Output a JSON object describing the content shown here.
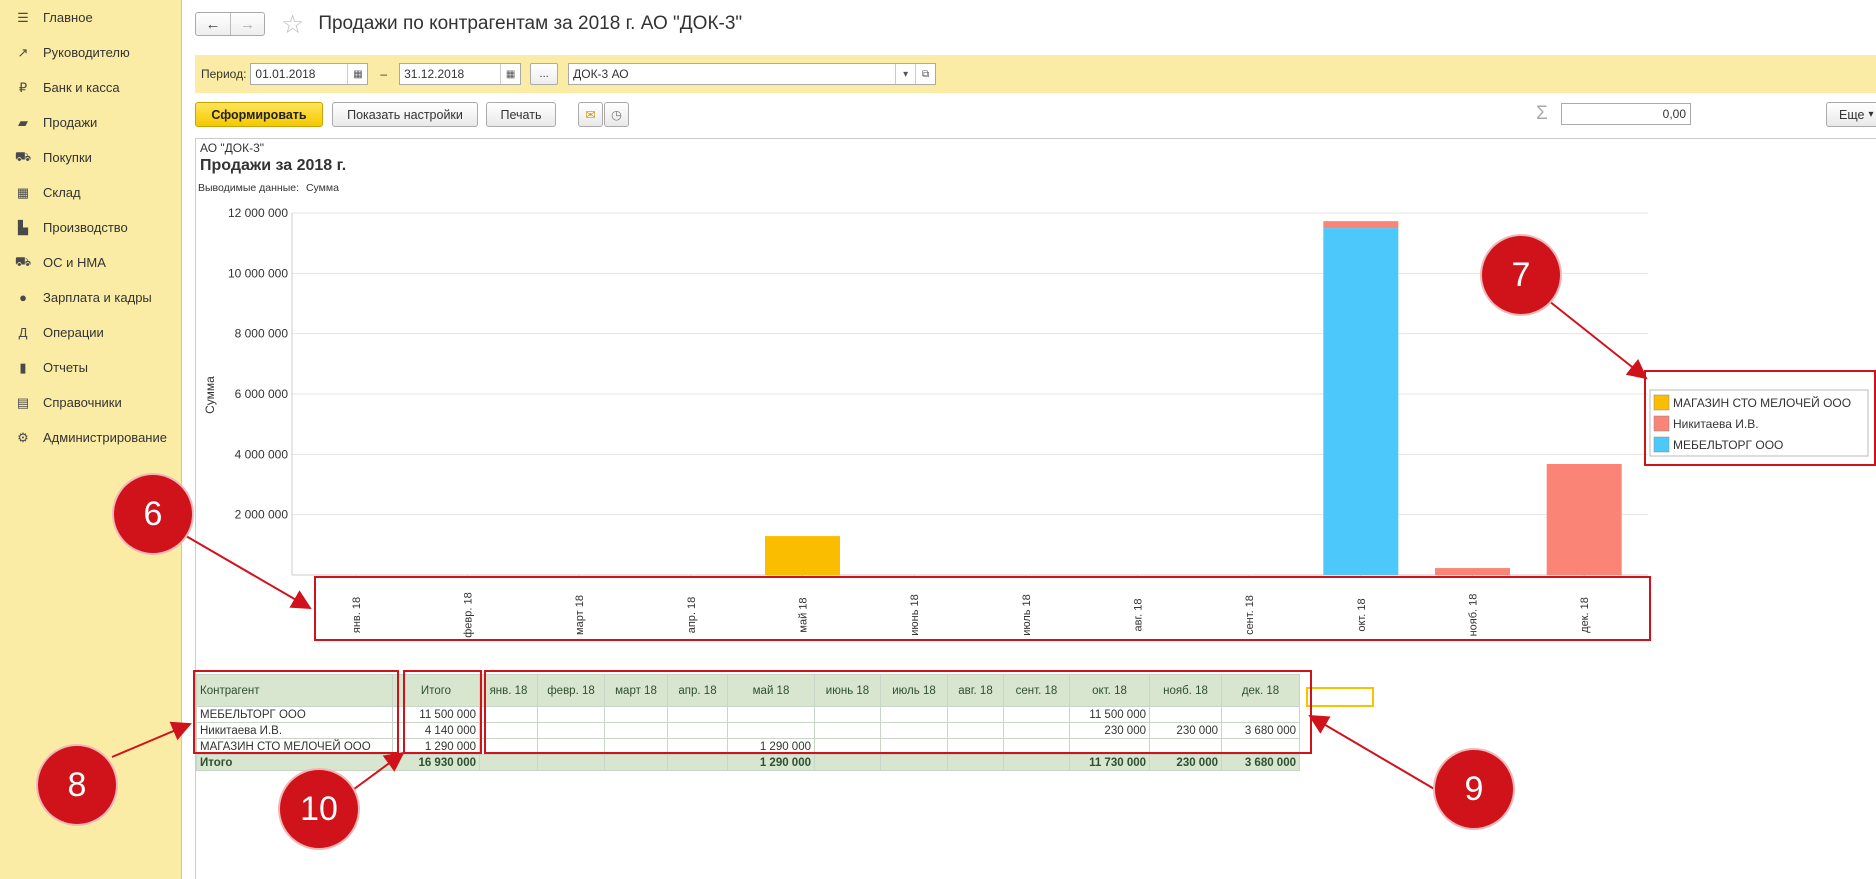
{
  "sidebar": {
    "items": [
      {
        "label": "Главное",
        "icon": "menu-icon"
      },
      {
        "label": "Руководителю",
        "icon": "trend-icon"
      },
      {
        "label": "Банк и касса",
        "icon": "ruble-icon"
      },
      {
        "label": "Продажи",
        "icon": "bag-icon"
      },
      {
        "label": "Покупки",
        "icon": "cart-icon"
      },
      {
        "label": "Склад",
        "icon": "grid-icon"
      },
      {
        "label": "Производство",
        "icon": "factory-icon"
      },
      {
        "label": "ОС и НМА",
        "icon": "truck-icon"
      },
      {
        "label": "Зарплата и кадры",
        "icon": "person-icon"
      },
      {
        "label": "Операции",
        "icon": "dt-kt-icon"
      },
      {
        "label": "Отчеты",
        "icon": "bar-chart-icon"
      },
      {
        "label": "Справочники",
        "icon": "book-icon"
      },
      {
        "label": "Администрирование",
        "icon": "gear-icon"
      }
    ]
  },
  "header": {
    "back": "←",
    "forward": "→",
    "title": "Продажи по контрагентам за 2018 г. АО \"ДОК-3\""
  },
  "filter": {
    "period_label": "Период:",
    "date_from": "01.01.2018",
    "dash": "–",
    "date_to": "31.12.2018",
    "ellipsis": "...",
    "org": "ДОК-3 АО"
  },
  "toolbar": {
    "generate": "Сформировать",
    "show_settings": "Показать настройки",
    "print": "Печать",
    "sigma": "Σ",
    "sum_value": "0,00",
    "more": "Еще"
  },
  "report": {
    "org_line": "АО \"ДОК-3\"",
    "heading": "Продажи за 2018 г.",
    "output_label": "Выводимые данные:",
    "output_value": "Сумма"
  },
  "chart_data": {
    "type": "bar",
    "stacked": true,
    "ylabel": "Сумма",
    "ylim": [
      0,
      12000000
    ],
    "yticks": [
      "12 000 000",
      "10 000 000",
      "8 000 000",
      "6 000 000",
      "4 000 000",
      "2 000 000"
    ],
    "categories": [
      "янв. 18",
      "февр. 18",
      "март 18",
      "апр. 18",
      "май 18",
      "июнь 18",
      "июль 18",
      "авг. 18",
      "сент. 18",
      "окт. 18",
      "нояб. 18",
      "дек. 18"
    ],
    "series": [
      {
        "name": "МАГАЗИН СТО МЕЛОЧЕЙ ООО",
        "color": "#fbbd00",
        "values": [
          0,
          0,
          0,
          0,
          1290000,
          0,
          0,
          0,
          0,
          0,
          0,
          0
        ]
      },
      {
        "name": "МЕБЕЛЬТОРГ ООО",
        "color": "#4dc8fb",
        "values": [
          0,
          0,
          0,
          0,
          0,
          0,
          0,
          0,
          0,
          11500000,
          0,
          0
        ]
      },
      {
        "name": "Никитаева И.В.",
        "color": "#fa8475",
        "values": [
          0,
          0,
          0,
          0,
          0,
          0,
          0,
          0,
          0,
          230000,
          230000,
          3680000
        ]
      }
    ],
    "legend_order": [
      "МАГАЗИН СТО МЕЛОЧЕЙ ООО",
      "Никитаева И.В.",
      "МЕБЕЛЬТОРГ ООО"
    ],
    "legend_position": "right",
    "grid": true
  },
  "table": {
    "headers": [
      "Контрагент",
      "Итого",
      "янв. 18",
      "февр. 18",
      "март 18",
      "апр. 18",
      "май 18",
      "июнь 18",
      "июль 18",
      "авг. 18",
      "сент. 18",
      "окт. 18",
      "нояб. 18",
      "дек. 18"
    ],
    "rows": [
      [
        "МЕБЕЛЬТОРГ ООО",
        "11 500 000",
        "",
        "",
        "",
        "",
        "",
        "",
        "",
        "",
        "",
        "11 500 000",
        "",
        ""
      ],
      [
        "Никитаева И.В.",
        "4 140 000",
        "",
        "",
        "",
        "",
        "",
        "",
        "",
        "",
        "",
        "230 000",
        "230 000",
        "3 680 000"
      ],
      [
        "МАГАЗИН СТО МЕЛОЧЕЙ ООО",
        "1 290 000",
        "",
        "",
        "",
        "",
        "1 290 000",
        "",
        "",
        "",
        "",
        "",
        "",
        ""
      ]
    ],
    "total": [
      "Итого",
      "16 930 000",
      "",
      "",
      "",
      "",
      "1 290 000",
      "",
      "",
      "",
      "",
      "11 730 000",
      "230 000",
      "3 680 000"
    ]
  },
  "annotations": {
    "badges": [
      "6",
      "7",
      "8",
      "9",
      "10"
    ],
    "color": "#d0121b"
  }
}
